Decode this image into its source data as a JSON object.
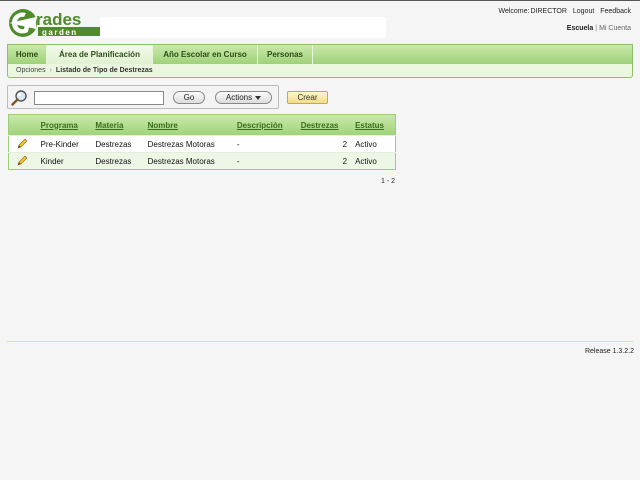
{
  "brand": {
    "logo_word_top": "rades",
    "logo_word_bottom": "garden",
    "logo_letter": "G",
    "logo_color": "#4f8a2b"
  },
  "user": {
    "welcome_label": "Welcome:",
    "username": "DIRECTOR",
    "logout": "Logout",
    "feedback": "Feedback",
    "escuela": "Escuela",
    "separator": "|",
    "mi_cuenta": "Mi Cuenta"
  },
  "tabs": [
    {
      "label": "Home",
      "active": false
    },
    {
      "label": "Área de Planificación",
      "active": true
    },
    {
      "label": "Año Escolar en Curso",
      "active": false
    },
    {
      "label": "Personas",
      "active": false
    }
  ],
  "breadcrumb": {
    "root": "Opciones",
    "arrow": "›",
    "current": "Listado de Tipo de Destrezas"
  },
  "search": {
    "value": "",
    "placeholder": "",
    "go_label": "Go",
    "actions_label": "Actions",
    "create_label": "Crear"
  },
  "table": {
    "columns": [
      "Programa",
      "Materia",
      "Nombre",
      "Descripción",
      "Destrezas",
      "Estatus"
    ],
    "rows": [
      {
        "programa": "Pre-Kinder",
        "materia": "Destrezas",
        "nombre": "Destrezas Motoras",
        "descripcion": "-",
        "destrezas": "2",
        "estatus": "Activo"
      },
      {
        "programa": "Kinder",
        "materia": "Destrezas",
        "nombre": "Destrezas Motoras",
        "descripcion": "-",
        "destrezas": "2",
        "estatus": "Activo"
      }
    ],
    "pagination": "1 - 2"
  },
  "footer": {
    "release": "Release 1.3.2.2"
  },
  "colors": {
    "accent_green": "#9fd27a",
    "tab_text": "#2e4d1a",
    "create_button": "#f3dc86"
  }
}
